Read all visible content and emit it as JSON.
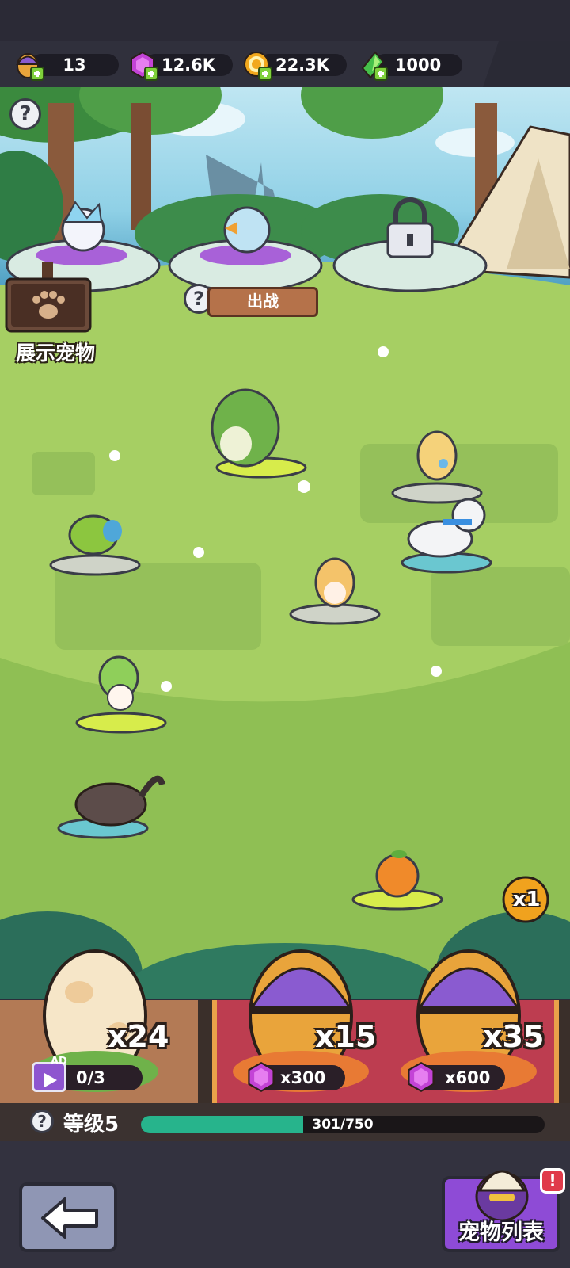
{
  "currencies": [
    {
      "name": "egg",
      "value": "13",
      "icon": "purple-egg-icon"
    },
    {
      "name": "gem",
      "value": "12.6K",
      "icon": "purple-gem-icon"
    },
    {
      "name": "coin",
      "value": "22.3K",
      "icon": "gold-coin-icon"
    },
    {
      "name": "crystal",
      "value": "1000",
      "icon": "green-crystal-icon"
    }
  ],
  "display": {
    "help_label": "?",
    "sign_label": "展示宠物",
    "battle_label": "出战"
  },
  "speed": {
    "label": "x1"
  },
  "shop": {
    "eggs": [
      {
        "count": "x24",
        "ad_label": "AD",
        "ad_progress": "0/3"
      },
      {
        "count": "x15",
        "price": "x300"
      },
      {
        "count": "x35",
        "price": "x600"
      }
    ],
    "level_label": "等级5",
    "progress_text": "301/750",
    "progress_fraction": 0.401
  },
  "footer": {
    "pet_list_label": "宠物列表",
    "alert": "!"
  }
}
